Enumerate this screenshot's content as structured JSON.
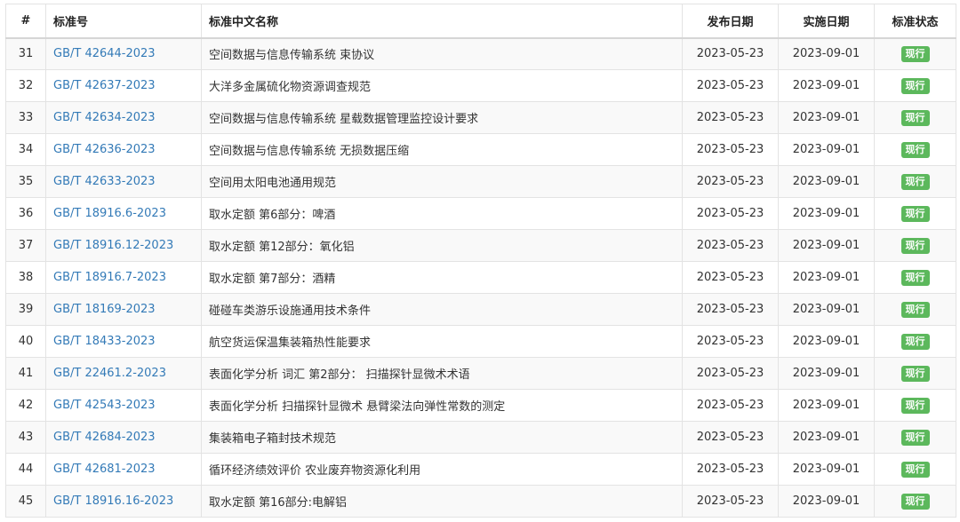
{
  "table": {
    "headers": {
      "num": "#",
      "code": "标准号",
      "name": "标准中文名称",
      "publish_date": "发布日期",
      "impl_date": "实施日期",
      "status": "标准状态"
    },
    "rows": [
      {
        "num": "31",
        "code": "GB/T 42644-2023",
        "name": "空间数据与信息传输系统 束协议",
        "publish_date": "2023-05-23",
        "impl_date": "2023-09-01",
        "status": "现行"
      },
      {
        "num": "32",
        "code": "GB/T 42637-2023",
        "name": "大洋多金属硫化物资源调查规范",
        "publish_date": "2023-05-23",
        "impl_date": "2023-09-01",
        "status": "现行"
      },
      {
        "num": "33",
        "code": "GB/T 42634-2023",
        "name": "空间数据与信息传输系统 星载数据管理监控设计要求",
        "publish_date": "2023-05-23",
        "impl_date": "2023-09-01",
        "status": "现行"
      },
      {
        "num": "34",
        "code": "GB/T 42636-2023",
        "name": "空间数据与信息传输系统 无损数据压缩",
        "publish_date": "2023-05-23",
        "impl_date": "2023-09-01",
        "status": "现行"
      },
      {
        "num": "35",
        "code": "GB/T 42633-2023",
        "name": "空间用太阳电池通用规范",
        "publish_date": "2023-05-23",
        "impl_date": "2023-09-01",
        "status": "现行"
      },
      {
        "num": "36",
        "code": "GB/T 18916.6-2023",
        "name": "取水定额 第6部分：啤酒",
        "publish_date": "2023-05-23",
        "impl_date": "2023-09-01",
        "status": "现行"
      },
      {
        "num": "37",
        "code": "GB/T 18916.12-2023",
        "name": "取水定额 第12部分：氧化铝",
        "publish_date": "2023-05-23",
        "impl_date": "2023-09-01",
        "status": "现行"
      },
      {
        "num": "38",
        "code": "GB/T 18916.7-2023",
        "name": "取水定额 第7部分：酒精",
        "publish_date": "2023-05-23",
        "impl_date": "2023-09-01",
        "status": "现行"
      },
      {
        "num": "39",
        "code": "GB/T 18169-2023",
        "name": "碰碰车类游乐设施通用技术条件",
        "publish_date": "2023-05-23",
        "impl_date": "2023-09-01",
        "status": "现行"
      },
      {
        "num": "40",
        "code": "GB/T 18433-2023",
        "name": "航空货运保温集装箱热性能要求",
        "publish_date": "2023-05-23",
        "impl_date": "2023-09-01",
        "status": "现行"
      },
      {
        "num": "41",
        "code": "GB/T 22461.2-2023",
        "name": "表面化学分析 词汇 第2部分： 扫描探针显微术术语",
        "publish_date": "2023-05-23",
        "impl_date": "2023-09-01",
        "status": "现行"
      },
      {
        "num": "42",
        "code": "GB/T 42543-2023",
        "name": "表面化学分析 扫描探针显微术 悬臂梁法向弹性常数的测定",
        "publish_date": "2023-05-23",
        "impl_date": "2023-09-01",
        "status": "现行"
      },
      {
        "num": "43",
        "code": "GB/T 42684-2023",
        "name": "集装箱电子箱封技术规范",
        "publish_date": "2023-05-23",
        "impl_date": "2023-09-01",
        "status": "现行"
      },
      {
        "num": "44",
        "code": "GB/T 42681-2023",
        "name": "循环经济绩效评价 农业废弃物资源化利用",
        "publish_date": "2023-05-23",
        "impl_date": "2023-09-01",
        "status": "现行"
      },
      {
        "num": "45",
        "code": "GB/T 18916.16-2023",
        "name": "取水定额 第16部分:电解铝",
        "publish_date": "2023-05-23",
        "impl_date": "2023-09-01",
        "status": "现行"
      }
    ]
  },
  "colors": {
    "link": "#337ab7",
    "badge_active": "#5cb85c",
    "row_stripe": "#f9f9f9"
  }
}
